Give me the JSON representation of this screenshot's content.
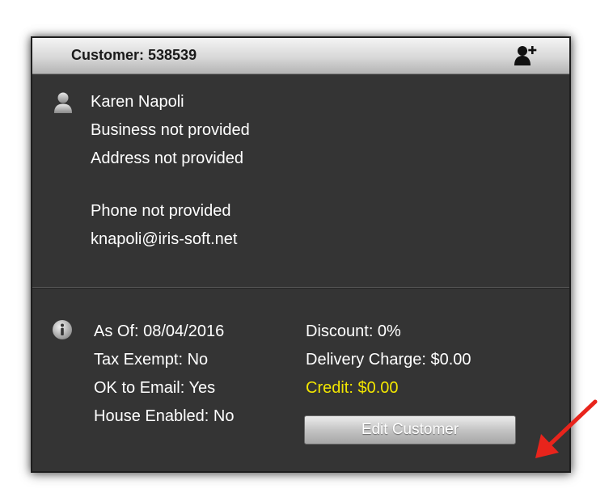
{
  "header": {
    "title": "Customer: 538539",
    "add_icon": "add-user-icon"
  },
  "contact": {
    "icon": "person-icon",
    "name": "Karen Napoli",
    "business": "Business not provided",
    "address": "Address not provided",
    "phone": "Phone not provided",
    "email": "knapoli@iris-soft.net"
  },
  "details": {
    "icon": "info-icon",
    "as_of": "As Of: 08/04/2016",
    "tax_exempt": "Tax Exempt: No",
    "ok_to_email": "OK to Email: Yes",
    "house_enabled": "House Enabled: No",
    "discount": "Discount: 0%",
    "delivery_charge": "Delivery Charge: $0.00",
    "credit": "Credit: $0.00"
  },
  "actions": {
    "edit_label": "Edit Customer"
  },
  "colors": {
    "panel_bg": "#343434",
    "credit_text": "#f2e600",
    "annotation_arrow": "#e8241c"
  }
}
